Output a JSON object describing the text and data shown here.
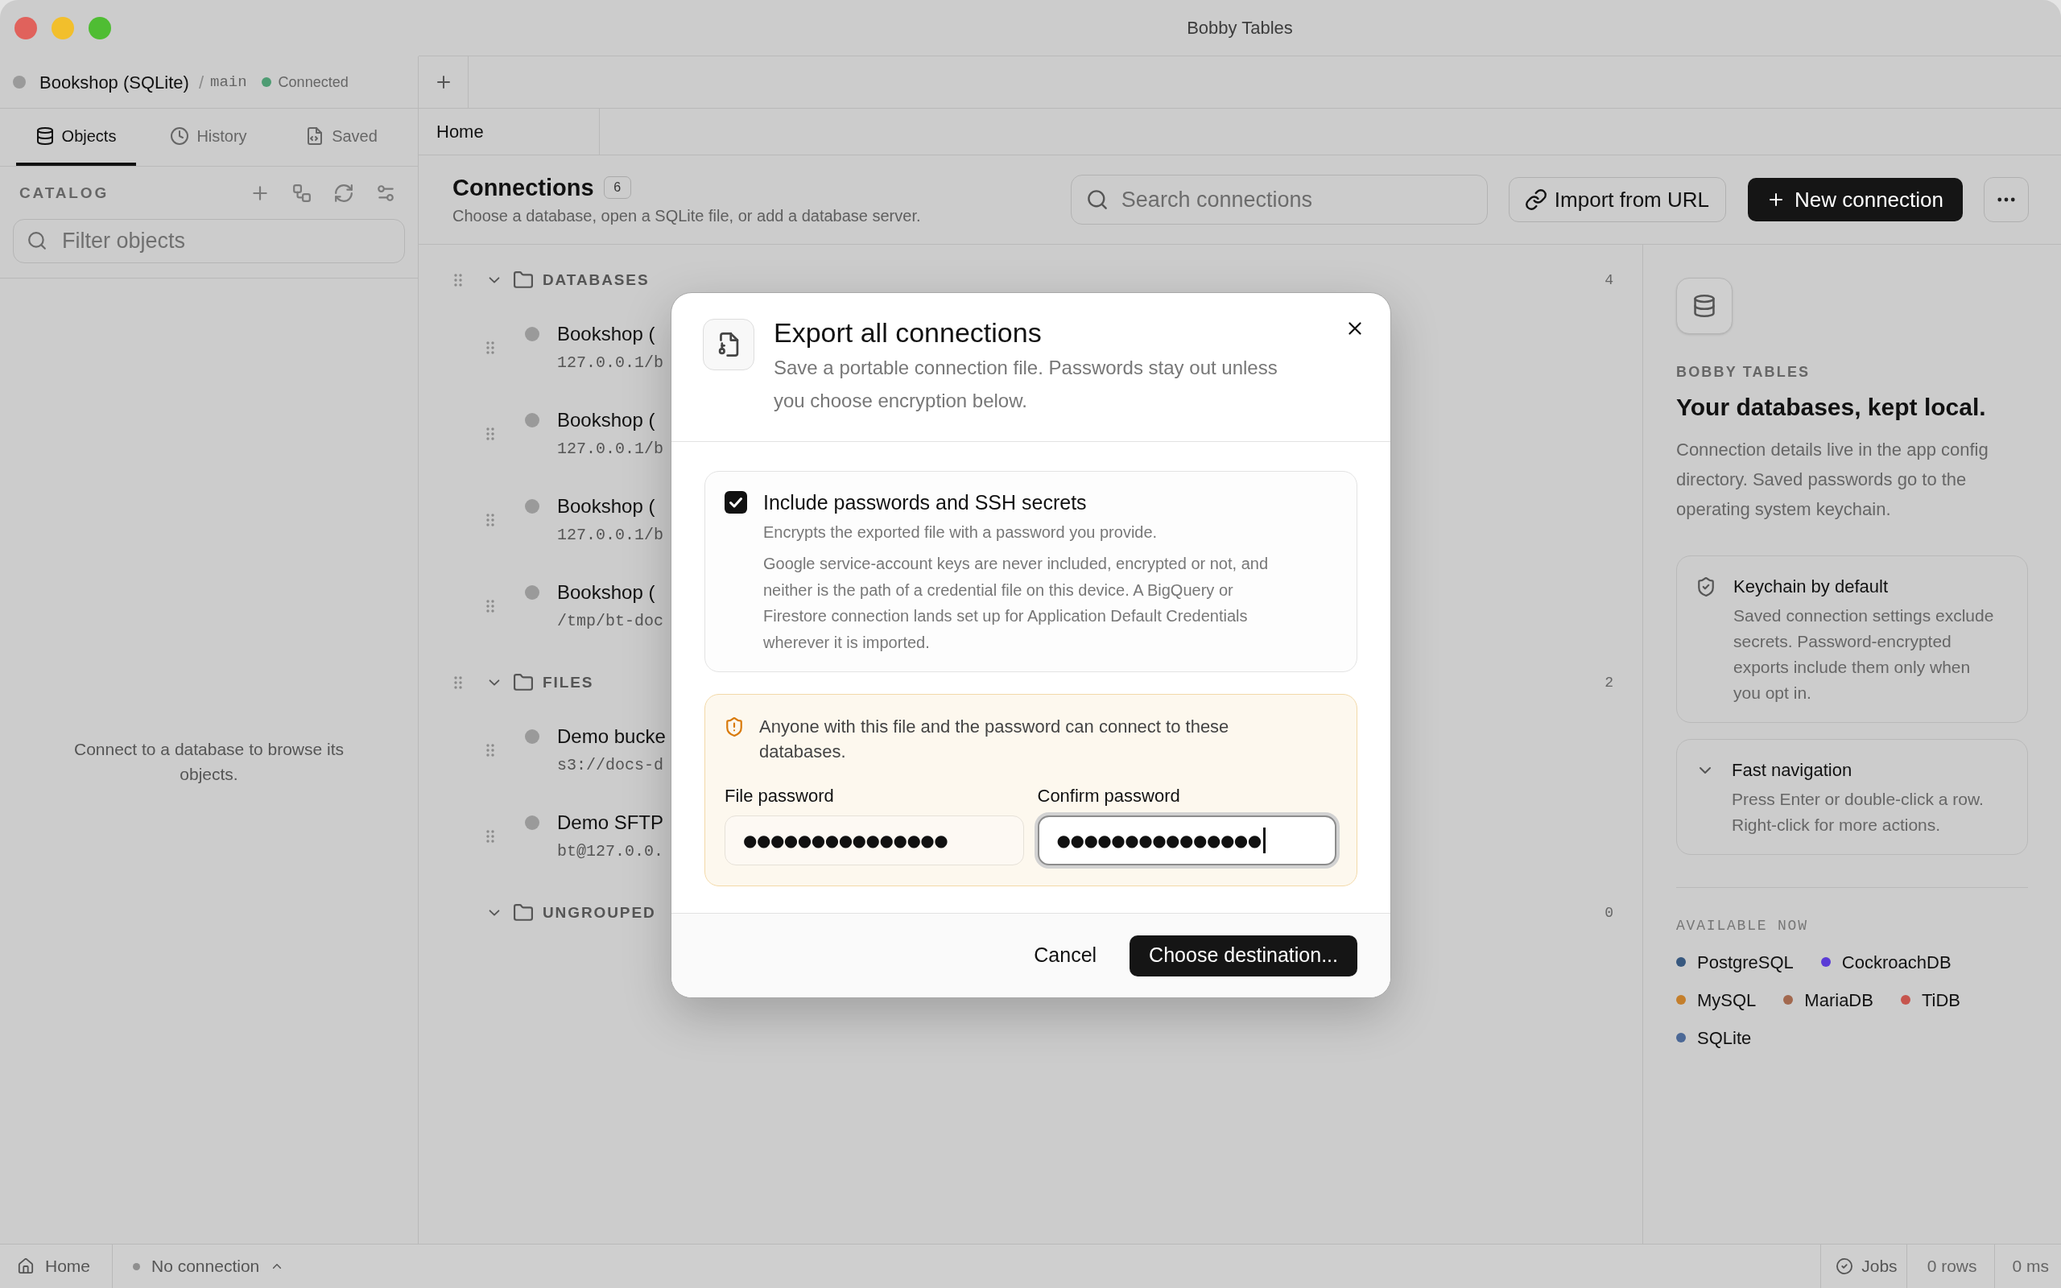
{
  "window": {
    "title": "Bobby Tables"
  },
  "sidebar": {
    "connection": {
      "name": "Bookshop (SQLite)",
      "separator": "/",
      "database": "main",
      "status": "Connected",
      "connected": true
    },
    "tabs": [
      {
        "label": "Objects",
        "selected": true
      },
      {
        "label": "History",
        "selected": false
      },
      {
        "label": "Saved",
        "selected": false
      }
    ],
    "catalog": {
      "title": "CATALOG",
      "filter": {
        "placeholder": "Filter objects"
      }
    },
    "empty_state": "Connect to a database to browse its objects."
  },
  "tab_strip": {
    "tabs": [
      {
        "label": "Home",
        "selected": true
      }
    ]
  },
  "header": {
    "title": "Connections",
    "count": "6",
    "subtitle": "Choose a database, open a SQLite file, or add a database server.",
    "search": {
      "placeholder": "Search connections"
    },
    "buttons": [
      {
        "kind": "import",
        "label": "Import from URL"
      },
      {
        "kind": "create",
        "label": "New connection"
      },
      {
        "kind": "more"
      }
    ]
  },
  "groups": [
    {
      "label": "DATABASES",
      "count": "4",
      "expanded": true,
      "draggable": true,
      "connections": [
        {
          "name": "Bookshop (",
          "address": "127.0.0.1/b"
        },
        {
          "name": "Bookshop (",
          "address": "127.0.0.1/b"
        },
        {
          "name": "Bookshop (",
          "address": "127.0.0.1/b"
        },
        {
          "name": "Bookshop (",
          "address": "/tmp/bt-doc"
        }
      ]
    },
    {
      "label": "FILES",
      "count": "2",
      "expanded": true,
      "draggable": true,
      "connections": [
        {
          "name": "Demo bucke",
          "address": "s3://docs-d"
        },
        {
          "name": "Demo SFTP",
          "address": "bt@127.0.0."
        }
      ]
    },
    {
      "label": "UNGROUPED",
      "count": "0",
      "expanded": true,
      "draggable": false
    }
  ],
  "dialog": {
    "title": "Export all connections",
    "subtitle": "Save a portable connection file. Passwords stay out unless you choose encryption below.",
    "option": {
      "label": "Include passwords and SSH secrets",
      "checked": true,
      "description": "Encrypts the exported file with a password you provide.",
      "note": "Google service-account keys are never included, encrypted or not, and neither is the path of a credential file on this device. A BigQuery or Firestore connection lands set up for Application Default Credentials wherever it is imported."
    },
    "warning": "Anyone with this file and the password can connect to these databases.",
    "fields": [
      {
        "label": "File password",
        "value": "●●●●●●●●●●●●●●●",
        "focused": false
      },
      {
        "label": "Confirm password",
        "value": "●●●●●●●●●●●●●●●",
        "focused": true
      }
    ],
    "buttons": [
      {
        "kind": "cancel",
        "label": "Cancel"
      },
      {
        "kind": "primary",
        "label": "Choose destination..."
      }
    ]
  },
  "info_panel": {
    "eyebrow": "BOBBY TABLES",
    "title": "Your databases, kept local.",
    "body": "Connection details live in the app config directory. Saved passwords go to the operating system keychain.",
    "cards": [
      {
        "kind": "security",
        "title": "Keychain by default",
        "body": "Saved connection settings exclude secrets. Password-encrypted exports include them only when you opt in."
      },
      {
        "kind": "collapsible",
        "expanded": true,
        "title": "Fast navigation",
        "body": "Press Enter or double-click a row. Right-click for more actions."
      }
    ],
    "available": {
      "title": "AVAILABLE NOW",
      "engines": [
        {
          "name": "PostgreSQL",
          "color": "#37587f"
        },
        {
          "name": "CockroachDB",
          "color": "#5a3bd6"
        },
        {
          "name": "MySQL",
          "color": "#c47f2c"
        },
        {
          "name": "MariaDB",
          "color": "#a2684e"
        },
        {
          "name": "TiDB",
          "color": "#c6554d"
        },
        {
          "name": "SQLite",
          "color": "#4b6896"
        }
      ]
    }
  },
  "status_bar": {
    "home": "Home",
    "connection": "No connection",
    "jobs": "Jobs",
    "rows": "0 rows",
    "duration": "0 ms"
  }
}
